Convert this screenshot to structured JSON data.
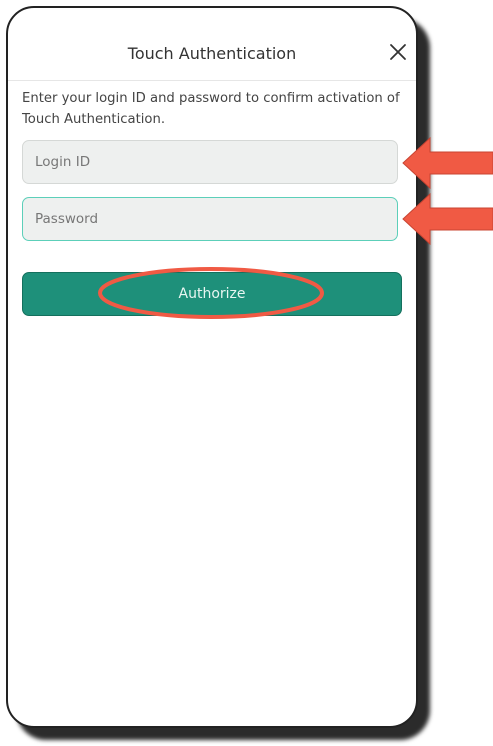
{
  "dialog": {
    "title": "Touch Authentication",
    "close_icon": "close-icon",
    "instructions": "Enter your login ID and password to confirm activation of Touch Authentication."
  },
  "form": {
    "login_placeholder": "Login ID",
    "password_placeholder": "Password",
    "authorize_label": "Authorize"
  },
  "colors": {
    "accent": "#1e907a",
    "focus_border": "#5ccfb9",
    "annotation": "#f05a44"
  }
}
